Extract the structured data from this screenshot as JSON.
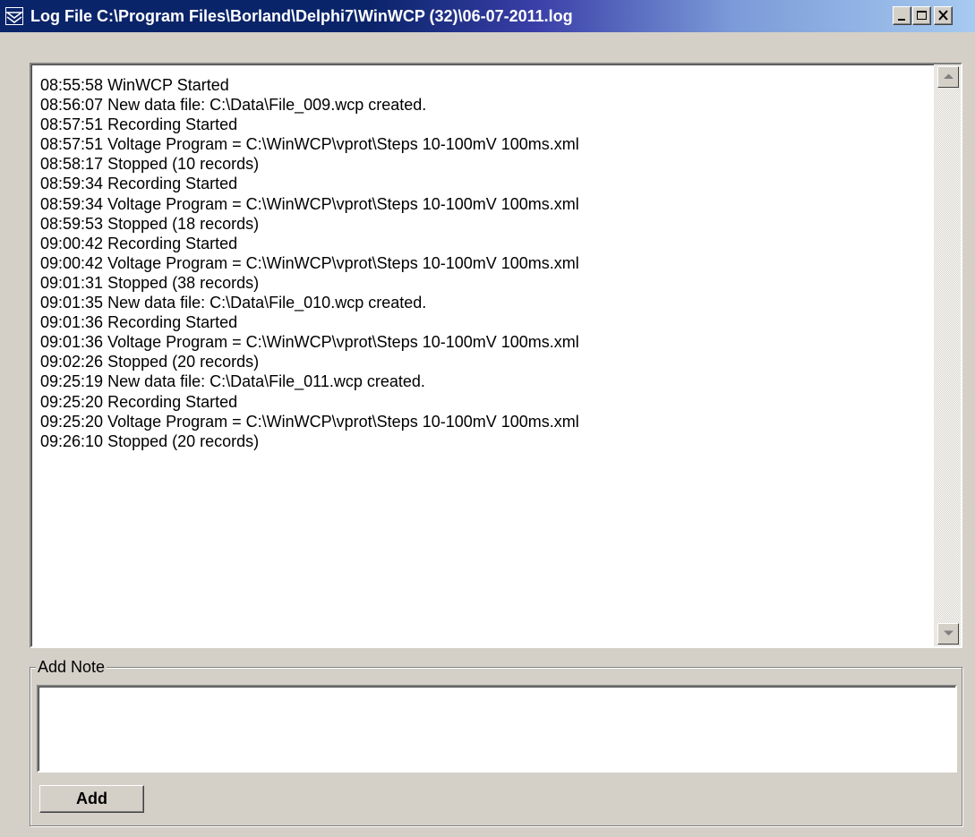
{
  "window": {
    "title": "Log File C:\\Program Files\\Borland\\Delphi7\\WinWCP (32)\\06-07-2011.log",
    "controls": [
      "minimize-icon",
      "maximize-icon",
      "close-icon"
    ]
  },
  "log": {
    "lines": [
      "08:55:58 WinWCP Started",
      "08:56:07 New data file: C:\\Data\\File_009.wcp created.",
      "08:57:51 Recording Started",
      "08:57:51 Voltage Program = C:\\WinWCP\\vprot\\Steps 10-100mV 100ms.xml",
      "08:58:17 Stopped (10 records)",
      "08:59:34 Recording Started",
      "08:59:34 Voltage Program = C:\\WinWCP\\vprot\\Steps 10-100mV 100ms.xml",
      "08:59:53 Stopped (18 records)",
      "09:00:42 Recording Started",
      "09:00:42 Voltage Program = C:\\WinWCP\\vprot\\Steps 10-100mV 100ms.xml",
      "09:01:31 Stopped (38 records)",
      "09:01:35 New data file: C:\\Data\\File_010.wcp created.",
      "09:01:36 Recording Started",
      "09:01:36 Voltage Program = C:\\WinWCP\\vprot\\Steps 10-100mV 100ms.xml",
      "09:02:26 Stopped (20 records)",
      "09:25:19 New data file: C:\\Data\\File_011.wcp created.",
      "09:25:20 Recording Started",
      "09:25:20 Voltage Program = C:\\WinWCP\\vprot\\Steps 10-100mV 100ms.xml",
      "09:26:10 Stopped (20 records)"
    ]
  },
  "note": {
    "group_label": "Add Note",
    "value": "",
    "add_label": "Add"
  },
  "colors": {
    "titlebar_start": "#0a246a",
    "titlebar_end": "#a6caf0",
    "face": "#d4d0c8"
  }
}
